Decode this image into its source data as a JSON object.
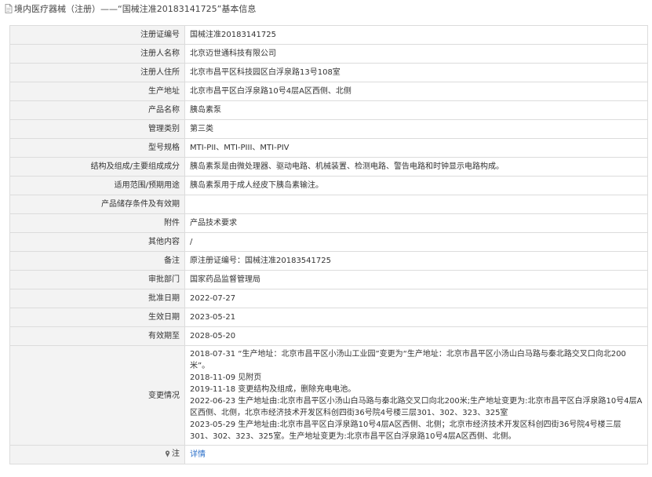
{
  "header": {
    "title": "境内医疗器械（注册）——“国械注准20183141725”基本信息"
  },
  "rows": [
    {
      "label": "注册证编号",
      "value": "国械注准20183141725"
    },
    {
      "label": "注册人名称",
      "value": "北京迈世通科技有限公司"
    },
    {
      "label": "注册人住所",
      "value": "北京市昌平区科技园区白浮泉路13号108室"
    },
    {
      "label": "生产地址",
      "value": "北京市昌平区白浮泉路10号4层A区西侧、北侧"
    },
    {
      "label": "产品名称",
      "value": "胰岛素泵"
    },
    {
      "label": "管理类别",
      "value": "第三类"
    },
    {
      "label": "型号规格",
      "value": "MTI-PII、MTI-PIII、MTI-PIV"
    },
    {
      "label": "结构及组成/主要组成成分",
      "value": "胰岛素泵是由微处理器、驱动电路、机械装置、检测电路、警告电路和时钟显示电路构成。"
    },
    {
      "label": "适用范围/预期用途",
      "value": "胰岛素泵用于成人经皮下胰岛素输注。"
    },
    {
      "label": "产品储存条件及有效期",
      "value": ""
    },
    {
      "label": "附件",
      "value": "产品技术要求"
    },
    {
      "label": "其他内容",
      "value": "/"
    },
    {
      "label": "备注",
      "value": "原注册证编号：国械注准20183541725"
    },
    {
      "label": "审批部门",
      "value": "国家药品监督管理局"
    },
    {
      "label": "批准日期",
      "value": "2022-07-27"
    },
    {
      "label": "生效日期",
      "value": "2023-05-21"
    },
    {
      "label": "有效期至",
      "value": "2028-05-20"
    }
  ],
  "changes": {
    "label": "变更情况",
    "lines": [
      "2018-07-31 “生产地址：北京市昌平区小汤山工业园”变更为“生产地址：北京市昌平区小汤山白马路与秦北路交叉口向北200米”。",
      "2018-11-09 见附页",
      "2019-11-18 变更结构及组成，删除充电电池。",
      "2022-06-23 生产地址由:北京市昌平区小汤山白马路与秦北路交叉口向北200米;生产地址变更为:北京市昌平区白浮泉路10号4层A区西侧、北侧，北京市经济技术开发区科创四街36号院4号楼三层301、302、323、325室",
      "2023-05-29 生产地址由:北京市昌平区白浮泉路10号4层A区西侧、北侧；北京市经济技术开发区科创四街36号院4号楼三层301、302、323、325室。生产地址变更为:北京市昌平区白浮泉路10号4层A区西侧、北侧。"
    ]
  },
  "note": {
    "label": "注",
    "link_text": "详情",
    "icon": "pin-icon"
  },
  "colors": {
    "label_bg": "#f3f3f3",
    "border": "#dcdcdc",
    "link": "#2a6fc9"
  }
}
